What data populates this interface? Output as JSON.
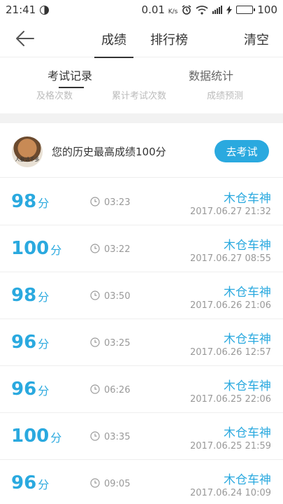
{
  "status_bar": {
    "time": "21:41",
    "speed": "0.01",
    "speed_unit": "K/s",
    "battery": "100",
    "battery_level": 1.0
  },
  "nav": {
    "tab_scores": "成绩",
    "tab_ranking": "排行榜",
    "clear": "清空"
  },
  "sub_tabs": {
    "records": "考试记录",
    "stats": "数据统计"
  },
  "stats_peek": [
    "及格次数",
    "累计考试次数",
    "成绩预测"
  ],
  "best": {
    "text": "您的历史最高成绩100分",
    "avatar_text": "人狠话不多",
    "button": "去考试"
  },
  "records": [
    {
      "score": "98",
      "unit": "分",
      "duration": "03:23",
      "name": "木仓车神",
      "date": "2017.06.27  21:32"
    },
    {
      "score": "100",
      "unit": "分",
      "duration": "03:22",
      "name": "木仓车神",
      "date": "2017.06.27  08:55"
    },
    {
      "score": "98",
      "unit": "分",
      "duration": "03:50",
      "name": "木仓车神",
      "date": "2017.06.26  21:06"
    },
    {
      "score": "96",
      "unit": "分",
      "duration": "03:25",
      "name": "木仓车神",
      "date": "2017.06.26  12:57"
    },
    {
      "score": "96",
      "unit": "分",
      "duration": "06:26",
      "name": "木仓车神",
      "date": "2017.06.25  22:06"
    },
    {
      "score": "100",
      "unit": "分",
      "duration": "03:35",
      "name": "木仓车神",
      "date": "2017.06.25  21:59"
    },
    {
      "score": "96",
      "unit": "分",
      "duration": "09:05",
      "name": "木仓车神",
      "date": "2017.06.24  10:09"
    }
  ],
  "colors": {
    "accent": "#2aa9df",
    "separator": "#eeeeee",
    "muted": "#999999"
  }
}
